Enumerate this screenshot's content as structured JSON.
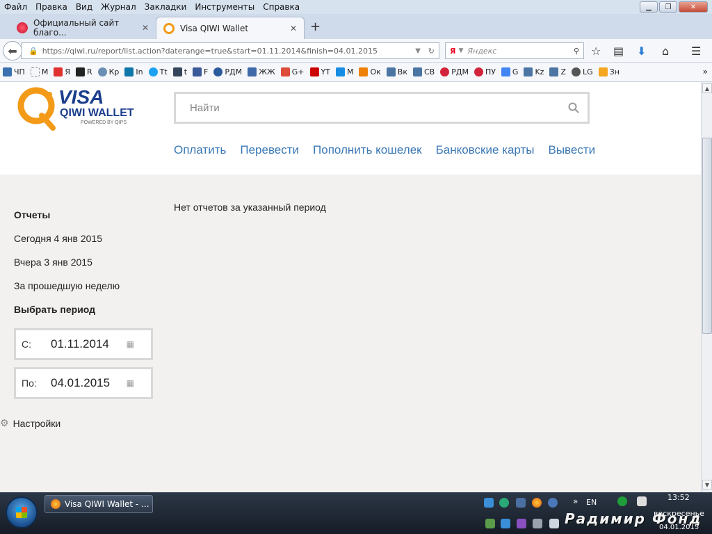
{
  "menubar": {
    "items": [
      "Файл",
      "Правка",
      "Вид",
      "Журнал",
      "Закладки",
      "Инструменты",
      "Справка"
    ]
  },
  "tabs": [
    {
      "title": "Официальный сайт благо...",
      "active": false
    },
    {
      "title": "Visa QIWI Wallet",
      "active": true
    }
  ],
  "navbar": {
    "url": "https://qiwi.ru/report/list.action?daterange=true&start=01.11.2014&finish=04.01.2015",
    "search_engine": "Я",
    "search_placeholder": "Яндекс"
  },
  "bookmarks": [
    {
      "label": "ЧП",
      "color": "#3a6fb0"
    },
    {
      "label": "М",
      "color": "#888888"
    },
    {
      "label": "Я",
      "color": "#e03030"
    },
    {
      "label": "R",
      "color": "#222222"
    },
    {
      "label": "Кр",
      "color": "#6a8fb5"
    },
    {
      "label": "In",
      "color": "#0e76a8"
    },
    {
      "label": "Tt",
      "color": "#1da1f2"
    },
    {
      "label": "t",
      "color": "#35465c"
    },
    {
      "label": "F",
      "color": "#3b5998"
    },
    {
      "label": "РДМ",
      "color": "#2b5b9c"
    },
    {
      "label": "ЖЖ",
      "color": "#3f6aa8"
    },
    {
      "label": "G+",
      "color": "#dd4b39"
    },
    {
      "label": "YT",
      "color": "#cc0000"
    },
    {
      "label": "М",
      "color": "#168de2"
    },
    {
      "label": "Ок",
      "color": "#ee8208"
    },
    {
      "label": "Вк",
      "color": "#4c75a3"
    },
    {
      "label": "СВ",
      "color": "#4c75a3"
    },
    {
      "label": "РДМ",
      "color": "#d3233a"
    },
    {
      "label": "ПУ",
      "color": "#d3233a"
    },
    {
      "label": "G",
      "color": "#4285f4"
    },
    {
      "label": "Kz",
      "color": "#4c75a3"
    },
    {
      "label": "Z",
      "color": "#4c75a3"
    },
    {
      "label": "LG",
      "color": "#555555"
    },
    {
      "label": "Зн",
      "color": "#f4a620"
    }
  ],
  "page": {
    "logo": {
      "line1": "VISA",
      "line2": "QIWI WALLET",
      "line3": "POWERED BY QIPS"
    },
    "search_placeholder": "Найти",
    "topnav": [
      "Оплатить",
      "Перевести",
      "Пополнить кошелек",
      "Банковские карты",
      "Вывести"
    ],
    "no_reports": "Нет отчетов за указанный период",
    "sidebar": {
      "title": "Отчеты",
      "today": "Сегодня 4 янв 2015",
      "yesterday": "Вчера 3 янв 2015",
      "last_week": "За прошедшую неделю",
      "choose_period": "Выбрать период"
    },
    "date_from": {
      "label": "С:",
      "value": "01.11.2014"
    },
    "date_to": {
      "label": "По:",
      "value": "04.01.2015"
    },
    "settings": "Настройки"
  },
  "taskbar": {
    "window_title": "Visa QIWI Wallet - ...",
    "lang": "EN",
    "time": "13:52",
    "day": "воскресенье",
    "date": "04.01.2015",
    "watermark": "Радимир Фонд"
  }
}
